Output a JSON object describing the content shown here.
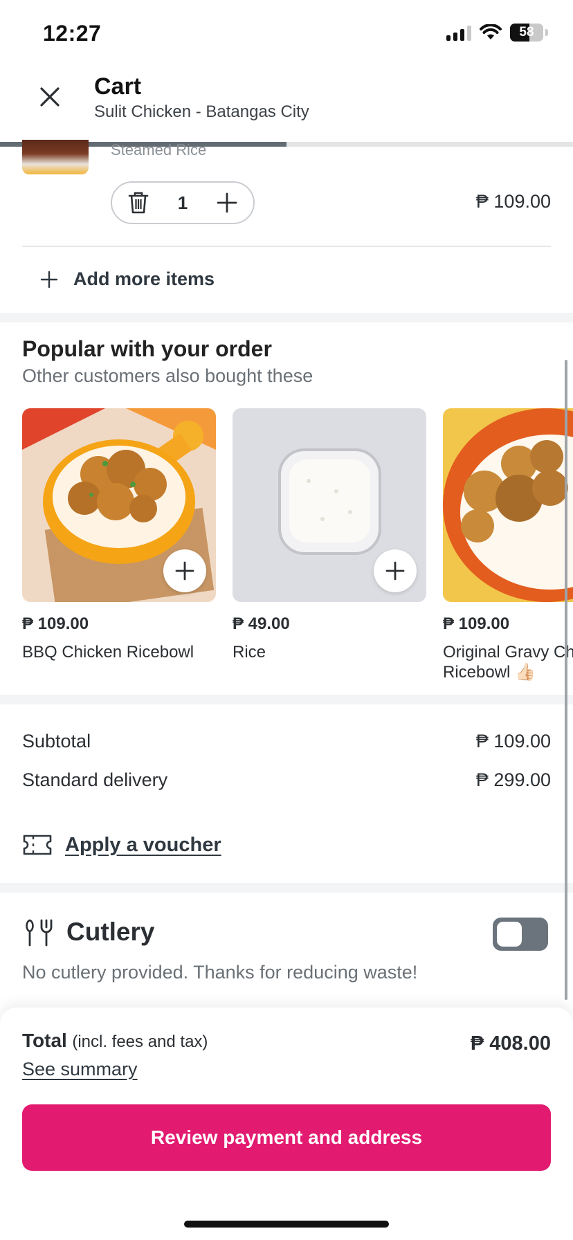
{
  "status_bar": {
    "time": "12:27",
    "battery": "58"
  },
  "header": {
    "title": "Cart",
    "subtitle": "Sulit Chicken - Batangas City"
  },
  "cart_item": {
    "description": "Steamed Rice",
    "quantity": "1",
    "price": "₱ 109.00"
  },
  "add_more": {
    "label": "Add more items"
  },
  "popular": {
    "title": "Popular with your order",
    "subtitle": "Other customers also bought these",
    "items": [
      {
        "price": "₱ 109.00",
        "name": "BBQ Chicken Ricebowl"
      },
      {
        "price": "₱ 49.00",
        "name": "Rice"
      },
      {
        "price": "₱ 109.00",
        "name": "Original Gravy Chicken",
        "name_line2": "Ricebowl 👍🏻"
      }
    ]
  },
  "summary": {
    "subtotal_label": "Subtotal",
    "subtotal_value": "₱ 109.00",
    "delivery_label": "Standard delivery",
    "delivery_value": "₱ 299.00",
    "voucher_label": "Apply a voucher"
  },
  "cutlery": {
    "title": "Cutlery",
    "description": "No cutlery provided. Thanks for reducing waste!",
    "enabled": false
  },
  "footer": {
    "total_label": "Total",
    "total_note": "(incl. fees and tax)",
    "total_value": "₱ 408.00",
    "see_summary": "See summary",
    "cta_label": "Review payment and address"
  },
  "colors": {
    "accent": "#e21b70",
    "toggle_off": "#6b747c",
    "text": "#2b2f33"
  }
}
